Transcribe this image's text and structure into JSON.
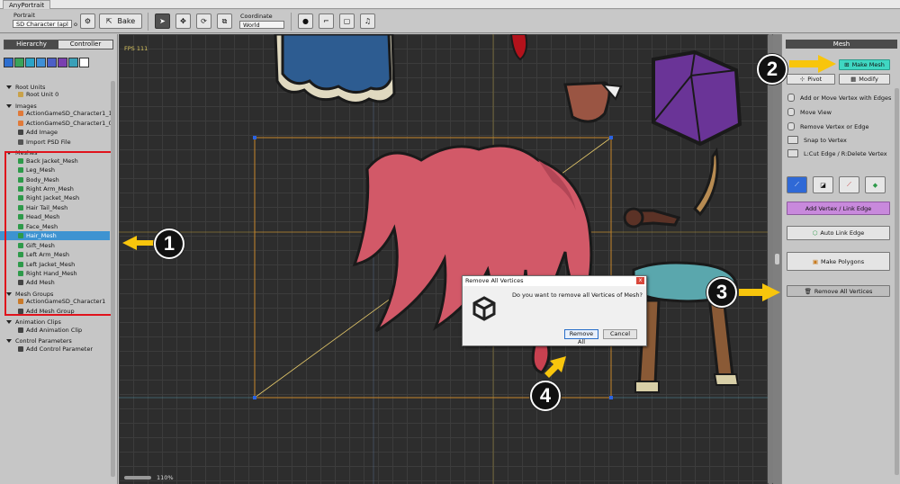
{
  "window": {
    "title": "AnyPortrait"
  },
  "toolbar": {
    "portrait_label": "Portrait",
    "portrait_value": "SD Character (apl",
    "portrait_suffix": "o",
    "bake_label": "Bake",
    "coordinate_label": "Coordinate",
    "coordinate_value": "World"
  },
  "left_panel": {
    "tabs": [
      {
        "label": "Hierarchy",
        "active": true
      },
      {
        "label": "Controller",
        "active": false
      }
    ],
    "icon_colors": [
      "#2e6fd0",
      "#3aa35a",
      "#2aa3c7",
      "#3e8fd6",
      "#4c5fc6",
      "#7a3fb0",
      "#3aa0b8",
      "#ffffff"
    ],
    "tree": [
      {
        "label": "Root Units",
        "kind": "section"
      },
      {
        "label": "Root Unit 0",
        "kind": "item",
        "icon": "root-unit-icon"
      },
      {
        "label": "Images",
        "kind": "section"
      },
      {
        "label": "ActionGameSD_Character1_1",
        "kind": "item",
        "icon": "image-icon"
      },
      {
        "label": "ActionGameSD_Character1_0",
        "kind": "item",
        "icon": "image-icon"
      },
      {
        "label": "Add Image",
        "kind": "item",
        "icon": "add-icon"
      },
      {
        "label": "Import PSD File",
        "kind": "item",
        "icon": "psd-icon"
      },
      {
        "label": "Meshes",
        "kind": "section"
      },
      {
        "label": "Back Jacket_Mesh",
        "kind": "item",
        "icon": "mesh-icon"
      },
      {
        "label": "Leg_Mesh",
        "kind": "item",
        "icon": "mesh-icon"
      },
      {
        "label": "Body_Mesh",
        "kind": "item",
        "icon": "mesh-icon"
      },
      {
        "label": "Right Arm_Mesh",
        "kind": "item",
        "icon": "mesh-icon"
      },
      {
        "label": "Right Jacket_Mesh",
        "kind": "item",
        "icon": "mesh-icon"
      },
      {
        "label": "Hair Tail_Mesh",
        "kind": "item",
        "icon": "mesh-icon"
      },
      {
        "label": "Head_Mesh",
        "kind": "item",
        "icon": "mesh-icon"
      },
      {
        "label": "Face_Mesh",
        "kind": "item",
        "icon": "mesh-icon"
      },
      {
        "label": "Hair_Mesh",
        "kind": "item",
        "icon": "mesh-icon",
        "selected": true
      },
      {
        "label": "Gift_Mesh",
        "kind": "item",
        "icon": "mesh-icon"
      },
      {
        "label": "Left Arm_Mesh",
        "kind": "item",
        "icon": "mesh-icon"
      },
      {
        "label": "Left Jacket_Mesh",
        "kind": "item",
        "icon": "mesh-icon"
      },
      {
        "label": "Right Hand_Mesh",
        "kind": "item",
        "icon": "mesh-icon"
      },
      {
        "label": "Add Mesh",
        "kind": "item",
        "icon": "add-icon"
      },
      {
        "label": "Mesh Groups",
        "kind": "section"
      },
      {
        "label": "ActionGameSD_Character1",
        "kind": "item",
        "icon": "mesh-group-icon"
      },
      {
        "label": "Add Mesh Group",
        "kind": "item",
        "icon": "add-icon"
      },
      {
        "label": "Animation Clips",
        "kind": "section"
      },
      {
        "label": "Add Animation Clip",
        "kind": "item",
        "icon": "add-icon"
      },
      {
        "label": "Control Parameters",
        "kind": "section"
      },
      {
        "label": "Add Control Parameter",
        "kind": "item",
        "icon": "add-icon"
      }
    ]
  },
  "canvas": {
    "fps": "FPS 111",
    "zoom": "110%"
  },
  "right_panel": {
    "header": "Mesh",
    "make_mesh": "Make Mesh",
    "pivot": "Pivot",
    "modify": "Modify",
    "tools": [
      "Add or Move Vertex with Edges",
      "Move View",
      "Remove Vertex or Edge",
      "Snap to Vertex",
      "L:Cut Edge / R:Delete Vertex"
    ],
    "add_vertex_link_edge": "Add Vertex / Link Edge",
    "auto_link_edge": "Auto Link Edge",
    "make_polygons": "Make Polygons",
    "remove_all_vertices": "Remove All Vertices"
  },
  "dialog": {
    "title": "Remove All Vertices",
    "close": "x",
    "message": "Do you want to remove all Vertices of Mesh?",
    "confirm": "Remove All",
    "cancel": "Cancel"
  },
  "callouts": [
    "1",
    "2",
    "3",
    "4"
  ],
  "colors": {
    "callout_arrow": "#f8c50c",
    "highlight_box": "#e0131c",
    "make_mesh_active": "#3fd7c2",
    "add_vertex_button": "#c889dc",
    "selection_blue": "#3e93d1",
    "canvas_bg": "#2d2d2d"
  }
}
